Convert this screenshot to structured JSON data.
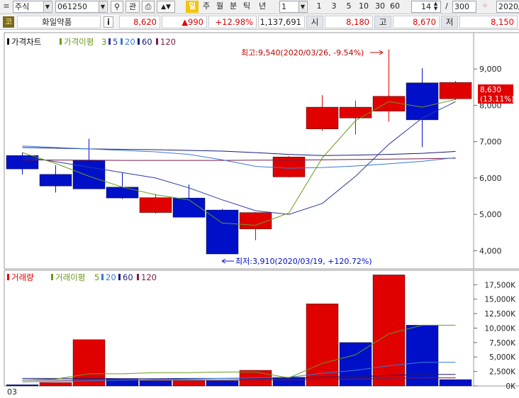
{
  "toolbar": {
    "market": "주식",
    "code": "061250",
    "relation": "관",
    "period_tabs": [
      "일",
      "주",
      "월",
      "분",
      "틱",
      "년"
    ],
    "unit_select": "1",
    "quick_units": [
      "1",
      "3",
      "5",
      "10",
      "30",
      "60"
    ],
    "display_count": "14",
    "slash": "/",
    "total_count": "300",
    "date_partial": "2020/"
  },
  "quote": {
    "badge": "코",
    "name": "화일약품",
    "info": "i",
    "price": "8,620",
    "change": "▲990",
    "change_pct": "+12.98%",
    "volume": "1,137,691",
    "open_label": "시",
    "open": "8,180",
    "high_label": "고",
    "high": "8,670",
    "low_label": "저",
    "low": "8,150"
  },
  "colors": {
    "up": "#e00000",
    "down": "#0010c8",
    "ma3": "#6a9a1e",
    "ma5": "#2c3aa0",
    "ma20": "#3a7ad8",
    "ma60": "#1a1a7a",
    "ma120": "#7a1a4a",
    "vol_ma5": "#6a9a1e"
  },
  "chart_data": [
    {
      "type": "candlestick",
      "legend": [
        "가격차트",
        "가격이평",
        "3",
        "5",
        "20",
        "60",
        "120"
      ],
      "ylim": [
        3500,
        10000
      ],
      "yticks": [
        "9,000",
        "8,000",
        "7,000",
        "6,000",
        "5,000",
        "4,000"
      ],
      "ytick_values": [
        9000,
        8000,
        7000,
        6000,
        5000,
        4000
      ],
      "candles": [
        {
          "open": 6620,
          "high": 6700,
          "low": 6100,
          "close": 6250
        },
        {
          "open": 6100,
          "high": 6350,
          "low": 5600,
          "close": 5780
        },
        {
          "open": 6480,
          "high": 7080,
          "low": 5900,
          "close": 5700
        },
        {
          "open": 5750,
          "high": 6150,
          "low": 5420,
          "close": 5450
        },
        {
          "open": 5050,
          "high": 5560,
          "low": 5020,
          "close": 5460
        },
        {
          "open": 5450,
          "high": 5820,
          "low": 4920,
          "close": 4920
        },
        {
          "open": 5120,
          "high": 5150,
          "low": 3910,
          "close": 3910
        },
        {
          "open": 4600,
          "high": 5060,
          "low": 4290,
          "close": 5050
        },
        {
          "open": 6030,
          "high": 6600,
          "low": 6020,
          "close": 6580
        },
        {
          "open": 7350,
          "high": 8280,
          "low": 7300,
          "close": 7950
        },
        {
          "open": 7650,
          "high": 8130,
          "low": 7200,
          "close": 7950
        },
        {
          "open": 7840,
          "high": 9540,
          "low": 7550,
          "close": 8250
        },
        {
          "open": 8620,
          "high": 9020,
          "low": 6850,
          "close": 7600
        },
        {
          "open": 8180,
          "high": 8670,
          "low": 8150,
          "close": 8630
        }
      ],
      "ma3": [
        6700,
        6400,
        6050,
        5750,
        5540,
        5400,
        4760,
        4700,
        5040,
        6550,
        7580,
        8100,
        7950,
        8160
      ],
      "ma5": [
        6580,
        6450,
        6300,
        6150,
        6000,
        5730,
        5400,
        5100,
        5000,
        5300,
        6050,
        6930,
        7650,
        8100
      ],
      "ma20": [
        6880,
        6840,
        6800,
        6760,
        6720,
        6650,
        6500,
        6320,
        6270,
        6290,
        6330,
        6390,
        6460,
        6560
      ],
      "ma60": [
        6840,
        6820,
        6800,
        6790,
        6780,
        6760,
        6740,
        6700,
        6650,
        6620,
        6630,
        6650,
        6680,
        6730
      ],
      "ma120": [
        6500,
        6495,
        6490,
        6485,
        6485,
        6485,
        6485,
        6490,
        6495,
        6500,
        6510,
        6520,
        6530,
        6545
      ],
      "current_label": "8,630",
      "current_pct": "(13.11%)",
      "max_annotation": "최고:9,540(2020/03/26, -9.54%)",
      "min_annotation": "최저:3,910(2020/03/19, +120.72%)"
    },
    {
      "type": "bar",
      "legend": [
        "거래량",
        "거래이평",
        "5",
        "20",
        "60",
        "120"
      ],
      "ylim": [
        0,
        19500000
      ],
      "yticks": [
        "17,500K",
        "15,000K",
        "12,500K",
        "10,000K",
        "7,500K",
        "5,000K",
        "2,500K",
        "0K"
      ],
      "ytick_values": [
        17500000,
        15000000,
        12500000,
        10000000,
        7500000,
        5000000,
        2500000,
        0
      ],
      "values": [
        200000,
        600000,
        8000000,
        1200000,
        900000,
        900000,
        900000,
        2700000,
        1500000,
        14200000,
        7500000,
        19200000,
        10500000,
        1100000
      ],
      "directions": [
        "down",
        "up",
        "up",
        "down",
        "down",
        "up",
        "down",
        "up",
        "down",
        "up",
        "down",
        "up",
        "down",
        "down"
      ],
      "ma5": [
        1000000,
        1200000,
        2100000,
        2100000,
        2300000,
        2300000,
        2400000,
        2400000,
        1400000,
        3900000,
        5400000,
        9000000,
        10500000,
        10500000
      ],
      "ma20": [
        700000,
        800000,
        900000,
        1000000,
        1100000,
        1200000,
        1300000,
        1400000,
        1500000,
        2200000,
        2700000,
        3500000,
        4100000,
        4100000
      ],
      "ma60": [
        1300000,
        1300000,
        1300000,
        1250000,
        1250000,
        1300000,
        1300000,
        1300000,
        1300000,
        1500000,
        1600000,
        1800000,
        2000000,
        2000000
      ],
      "ma120": [
        1000000,
        1000000,
        1000000,
        1000000,
        1000000,
        1000000,
        1000000,
        1050000,
        1050000,
        1150000,
        1200000,
        1300000,
        1400000,
        1400000
      ],
      "x_start_label": "03"
    }
  ]
}
